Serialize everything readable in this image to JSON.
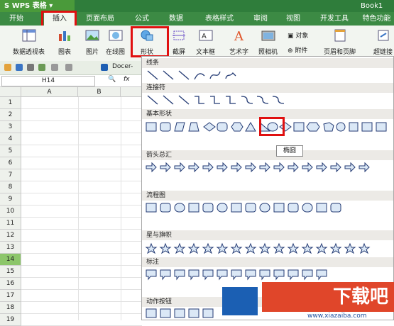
{
  "app": {
    "name": "WPS 表格",
    "document_title": "Book1"
  },
  "menu": {
    "items": [
      "开始",
      "插入",
      "页面布局",
      "公式",
      "数据",
      "表格样式",
      "审阅",
      "视图",
      "开发工具",
      "特色功能"
    ],
    "active": "插入"
  },
  "ribbon": {
    "buttons": [
      {
        "label": "数据透视表",
        "icon": "pivot-table-icon"
      },
      {
        "label": "图表",
        "icon": "chart-icon"
      },
      {
        "label": "图片",
        "icon": "picture-icon"
      },
      {
        "label": "在线图",
        "icon": "online-picture-icon"
      },
      {
        "label": "形状",
        "icon": "shapes-icon"
      },
      {
        "label": "截屏",
        "icon": "screenshot-icon"
      },
      {
        "label": "文本框",
        "icon": "textbox-icon"
      },
      {
        "label": "艺术字",
        "icon": "wordart-icon"
      },
      {
        "label": "照相机",
        "icon": "camera-icon"
      },
      {
        "label": "对象",
        "icon": "object-icon"
      },
      {
        "label": "附件",
        "icon": "attachment-icon"
      },
      {
        "label": "页眉和页脚",
        "icon": "header-footer-icon"
      },
      {
        "label": "超链接",
        "icon": "hyperlink-icon"
      }
    ]
  },
  "quickbar": {
    "docer_label": "Docer-"
  },
  "formula": {
    "cell_name": "H14",
    "fx_label": "fx"
  },
  "grid": {
    "columns": [
      "A",
      "B"
    ],
    "rows": [
      "1",
      "2",
      "3",
      "4",
      "5",
      "6",
      "7",
      "8",
      "9",
      "10",
      "11",
      "12",
      "13",
      "14",
      "15",
      "16",
      "17",
      "18",
      "19"
    ],
    "selected_row": "14"
  },
  "shapes_panel": {
    "sections": [
      "线条",
      "连接符",
      "基本形状",
      "箭头总汇",
      "流程图",
      "星与旗帜",
      "标注",
      "动作按钮"
    ],
    "tooltip": "椭圆"
  },
  "watermark": {
    "text": "下载吧",
    "url": "www.xiazaiba.com"
  },
  "colors": {
    "title_green": "#2f7d3b",
    "menu_green": "#3c8a44",
    "highlight_red": "#e01010",
    "selected_row": "#8cc66a",
    "watermark_orange": "#e0462a",
    "watermark_blue": "#1b5fb3"
  }
}
